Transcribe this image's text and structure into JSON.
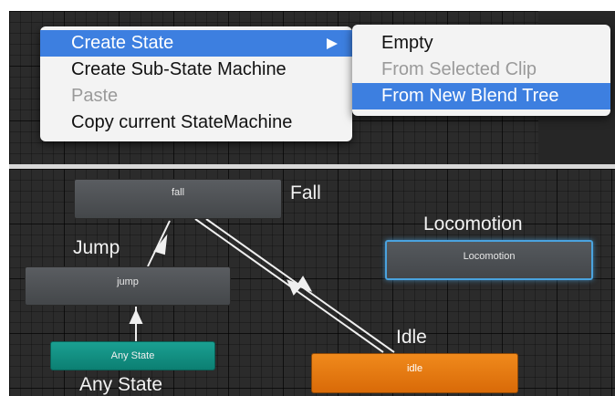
{
  "context_menu": {
    "items": [
      {
        "label": "Create State",
        "state": "highlighted",
        "has_submenu": true
      },
      {
        "label": "Create Sub-State Machine",
        "state": "normal"
      },
      {
        "label": "Paste",
        "state": "disabled"
      },
      {
        "label": "Copy current StateMachine",
        "state": "normal"
      }
    ]
  },
  "submenu": {
    "items": [
      {
        "label": "Empty",
        "state": "normal"
      },
      {
        "label": "From Selected Clip",
        "state": "disabled"
      },
      {
        "label": "From New Blend Tree",
        "state": "highlighted"
      }
    ]
  },
  "states": {
    "fall": {
      "name": "fall",
      "caption": "Fall"
    },
    "jump": {
      "name": "jump",
      "caption": "Jump"
    },
    "locomotion": {
      "name": "Locomotion",
      "caption": "Locomotion"
    },
    "any_state": {
      "name": "Any State",
      "caption": "Any State"
    },
    "idle": {
      "name": "idle",
      "caption": "Idle"
    }
  },
  "colors": {
    "highlight": "#3d7fe0",
    "any_state": "#14907f",
    "default_state": "#e57a12",
    "selected_outline": "#4aa3df",
    "graph_background": "#2b2b2b"
  }
}
